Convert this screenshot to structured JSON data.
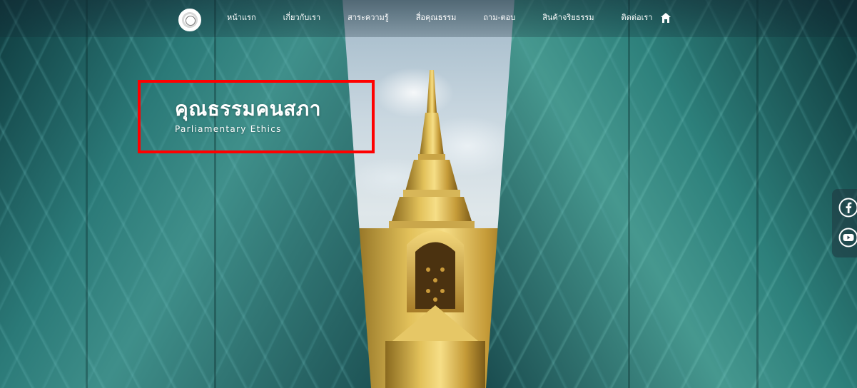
{
  "nav": {
    "items": [
      {
        "label": "หน้าแรก"
      },
      {
        "label": "เกี่ยวกับเรา"
      },
      {
        "label": "สาระความรู้"
      },
      {
        "label": "สื่อคุณธรรม"
      },
      {
        "label": "ถาม-ตอบ"
      },
      {
        "label": "สินค้าจริยธรรม"
      },
      {
        "label": "ติดต่อเรา"
      }
    ],
    "logo_icon": "parliament-seal-icon",
    "home_icon": "home-icon"
  },
  "hero": {
    "title": "คุณธรรมคนสภา",
    "subtitle": "Parliamentary Ethics",
    "highlight_color": "#ff0000"
  },
  "social": {
    "icons": [
      "facebook-icon",
      "youtube-icon"
    ]
  }
}
